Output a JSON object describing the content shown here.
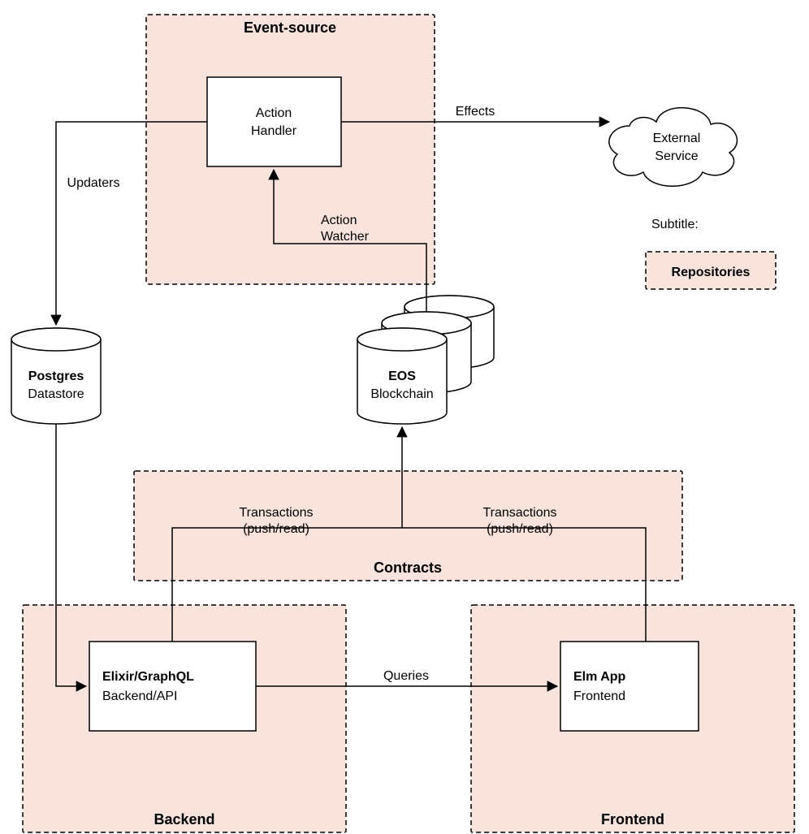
{
  "repos": {
    "event_source": "Event-source",
    "contracts": "Contracts",
    "backend": "Backend",
    "frontend": "Frontend"
  },
  "nodes": {
    "action_handler": {
      "line1": "Action",
      "line2": "Handler"
    },
    "external_service": {
      "line1": "External",
      "line2": "Service"
    },
    "postgres": {
      "title": "Postgres",
      "sub": "Datastore"
    },
    "eos": {
      "title": "EOS",
      "sub": "Blockchain"
    },
    "elixir": {
      "title": "Elixir/GraphQL",
      "sub": "Backend/API"
    },
    "elm": {
      "title": "Elm App",
      "sub": "Frontend"
    }
  },
  "edges": {
    "effects": "Effects",
    "updaters": "Updaters",
    "action_watcher": {
      "line1": "Action",
      "line2": "Watcher"
    },
    "transactions": {
      "line1": "Transactions",
      "line2": "(push/read)"
    },
    "queries": "Queries"
  },
  "subtitle": {
    "label": "Subtitle:",
    "legend": "Repositories"
  }
}
